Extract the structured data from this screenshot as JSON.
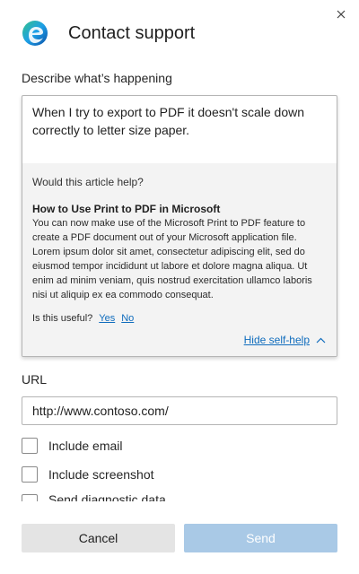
{
  "dialog": {
    "title": "Contact support",
    "close_icon": "close-icon",
    "logo_icon": "edge-logo"
  },
  "describe": {
    "label": "Describe what’s happening",
    "text": "When I try to export to PDF it doesn't scale down correctly to letter size paper."
  },
  "selfhelp": {
    "prompt": "Would this article help?",
    "article_title": "How to Use Print to PDF in Microsoft",
    "article_body": "You can now make use of the Microsoft Print to PDF feature to create a PDF document out of your Microsoft application file. Lorem ipsum dolor sit amet, consectetur adipiscing elit, sed do eiusmod tempor incididunt ut labore et dolore magna aliqua. Ut enim ad minim veniam, quis nostrud exercitation ullamco laboris nisi ut aliquip ex ea commodo consequat.",
    "useful_label": "Is this useful?",
    "yes": "Yes",
    "no": "No",
    "hide_label": "Hide self-help",
    "hide_icon": "chevron-up-icon"
  },
  "url": {
    "label": "URL",
    "value": "http://www.contoso.com/"
  },
  "options": [
    {
      "label": "Include email",
      "checked": false
    },
    {
      "label": "Include screenshot",
      "checked": false
    },
    {
      "label": "Send diagnostic data",
      "checked": false
    }
  ],
  "footer": {
    "cancel_label": "Cancel",
    "send_label": "Send"
  },
  "colors": {
    "link": "#0f6cbd",
    "send_disabled": "#a9c9e6",
    "cancel_bg": "#e4e4e4",
    "selfhelp_bg": "#f3f3f3"
  }
}
